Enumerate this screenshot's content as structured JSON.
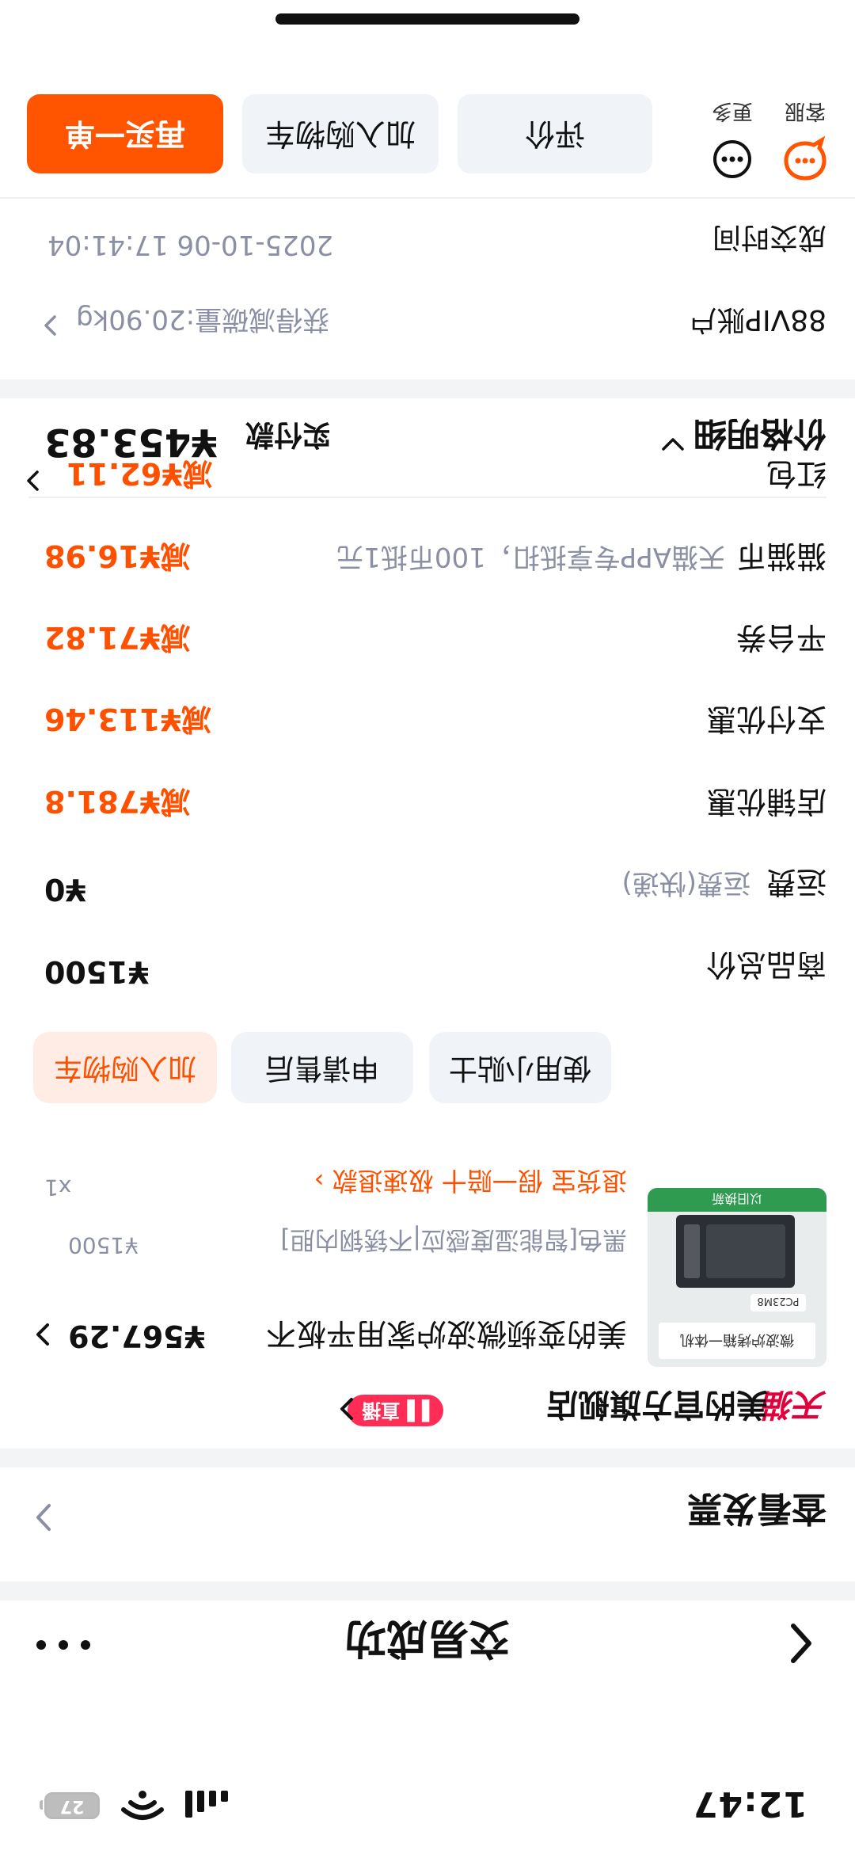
{
  "status_bar": {
    "time": "12:47",
    "battery": "27"
  },
  "header": {
    "title": "交易成功"
  },
  "invoice": {
    "label": "查看发票"
  },
  "shop": {
    "tmall": "天猫",
    "name": "美的官方旗舰店",
    "live": "直播"
  },
  "product": {
    "title": "美的变频微波炉家用平板不",
    "price": "¥567.29",
    "spec": "黑色[智能湿度感应|不锈钢内胆]",
    "original_price": "¥1500",
    "services": "退货宝  假一赔十  极速退款",
    "quantity": "x1",
    "image_text": {
      "headline": "微波炉烤箱一体机",
      "model": "PC23M8",
      "promo": "以旧换新"
    },
    "actions": [
      "使用小贴士",
      "申请售后",
      "加入购物车"
    ]
  },
  "costs": {
    "goods_total": {
      "label": "商品总价",
      "value": "¥1500"
    },
    "shipping": {
      "label": "运费",
      "sub": "运费(快递)",
      "value": "¥0"
    },
    "shop_discount": {
      "label": "店铺优惠",
      "value": "减¥781.8"
    },
    "pay_discount": {
      "label": "支付优惠",
      "value": "减¥113.46"
    },
    "platform_coupon": {
      "label": "平台券",
      "value": "减¥71.82"
    },
    "tmall_coin": {
      "label": "猫猫币",
      "sub": "天猫APP专享抵扣，100币抵1元",
      "value": "减¥16.98"
    },
    "red_packet": {
      "label": "红包",
      "value": "减¥62.11"
    }
  },
  "price_detail": {
    "title": "价格明细",
    "paid_label": "实付款",
    "paid_value": "¥453.83"
  },
  "order_info": {
    "account": {
      "label": "88VIP账户",
      "value": "获得减碳量:20.90kg"
    },
    "deal_time": {
      "label": "成交时间",
      "value": "2025-10-06 17:41:04"
    }
  },
  "bottom_bar": {
    "service_label": "客服",
    "more_label": "更多",
    "review": "评价",
    "add_cart": "加入购物车",
    "buy_again": "再买一单"
  },
  "colors": {
    "accent": "#ff5500",
    "tmall": "#e1003c"
  }
}
